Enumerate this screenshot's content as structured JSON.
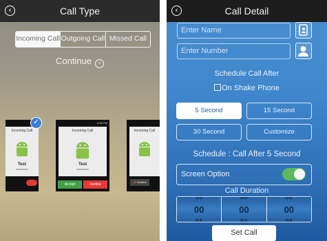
{
  "left": {
    "title": "Call Type",
    "tabs": [
      "Incoming Call",
      "Outgoing Call",
      "Missed Call"
    ],
    "continue_label": "Continue",
    "previews": [
      {
        "header": "Incoming Call",
        "name": "Test",
        "number": "xxxxxxxxx",
        "accept": "",
        "decline": ""
      },
      {
        "header": "Incoming Call",
        "name": "Test",
        "number": "xxxxxxxxx",
        "accept": "Accept",
        "decline": "Decline",
        "clock": "6:48 PM"
      },
      {
        "header": "Incoming Call",
        "name": "Test",
        "number": "xxxxxxxxx",
        "accept": "",
        "decline": "Decline"
      }
    ]
  },
  "right": {
    "title": "Call Detail",
    "name_placeholder": "Enter Name",
    "number_placeholder": "Enter Number",
    "schedule_label": "Schedule Call After",
    "shake_label": "On Shake Phone",
    "options": [
      "5 Second",
      "15 Second",
      "30 Second",
      "Customize"
    ],
    "schedule_status": "Schedule : Call After 5 Second",
    "screen_option_label": "Screen Option",
    "call_duration_label": "Call Duration",
    "duration": {
      "columns": [
        {
          "prev": "00",
          "value": "00",
          "next": "01"
        },
        {
          "prev": "00",
          "value": "00",
          "next": "01"
        },
        {
          "prev": "00",
          "value": "00",
          "next": "01"
        }
      ]
    },
    "set_call_label": "Set Call"
  }
}
